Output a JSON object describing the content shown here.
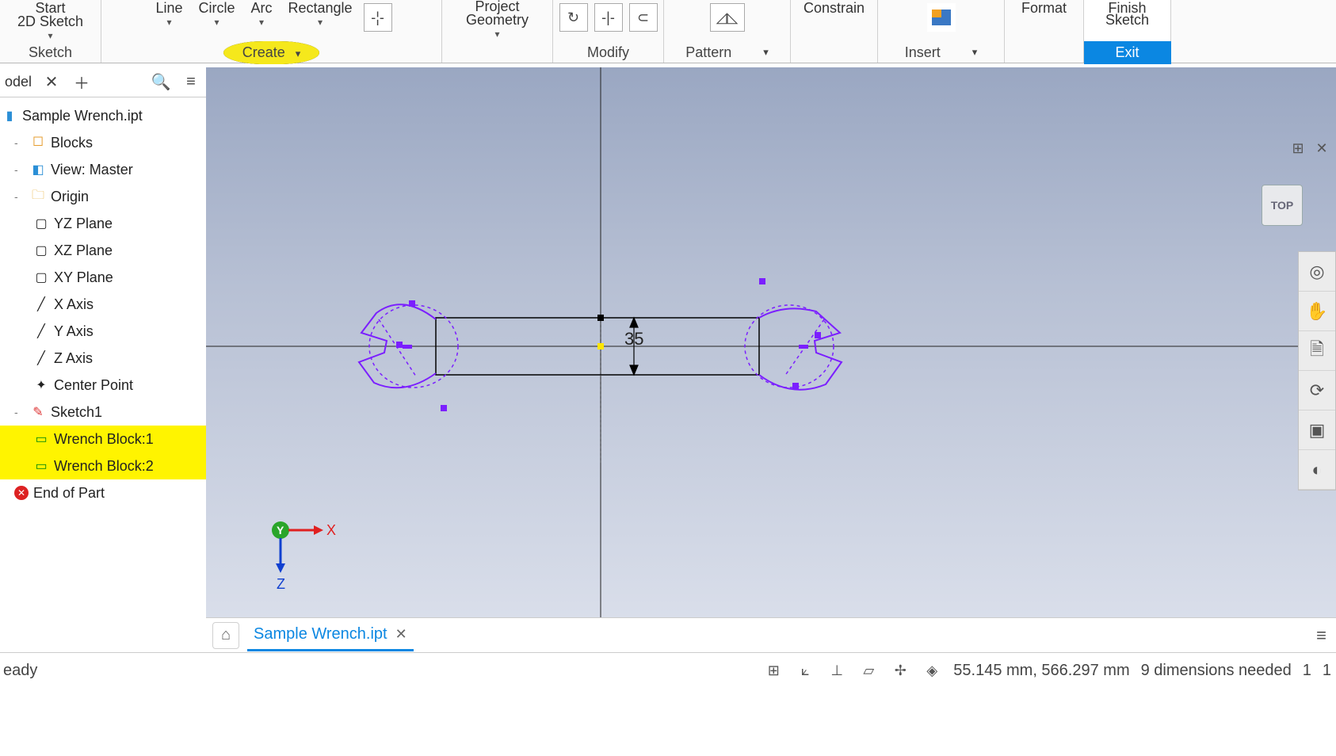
{
  "ribbon": {
    "start_top": "Start",
    "start_bottom": "2D Sketch",
    "sketch_panel": "Sketch",
    "line": "Line",
    "circle": "Circle",
    "arc": "Arc",
    "rectangle": "Rectangle",
    "create_panel": "Create",
    "project_top": "Project",
    "project_bottom": "Geometry",
    "modify_panel": "Modify",
    "pattern_panel": "Pattern",
    "constrain": "Constrain",
    "insert_panel": "Insert",
    "format": "Format",
    "finish_top": "Finish",
    "finish_bottom": "Sketch",
    "exit_label": "Exit"
  },
  "panel": {
    "model_label": "odel",
    "tree": {
      "root": "Sample Wrench.ipt",
      "blocks": "Blocks",
      "view": "View: Master",
      "origin": "Origin",
      "planes": {
        "yz": "YZ Plane",
        "xz": "XZ Plane",
        "xy": "XY Plane"
      },
      "axes": {
        "x": "X Axis",
        "y": "Y Axis",
        "z": "Z Axis"
      },
      "center": "Center Point",
      "sketch": "Sketch1",
      "block1": "Wrench Block:1",
      "block2": "Wrench Block:2",
      "eop": "End of Part"
    }
  },
  "canvas": {
    "dim_value": "35",
    "view_cube": "TOP",
    "triad": {
      "x": "X",
      "y": "Y",
      "z": "Z"
    }
  },
  "tabs": {
    "doc": "Sample Wrench.ipt"
  },
  "status": {
    "ready": "eady",
    "coords": "55.145 mm, 566.297 mm",
    "dims_needed": "9 dimensions needed",
    "n1": "1",
    "n2": "1"
  }
}
